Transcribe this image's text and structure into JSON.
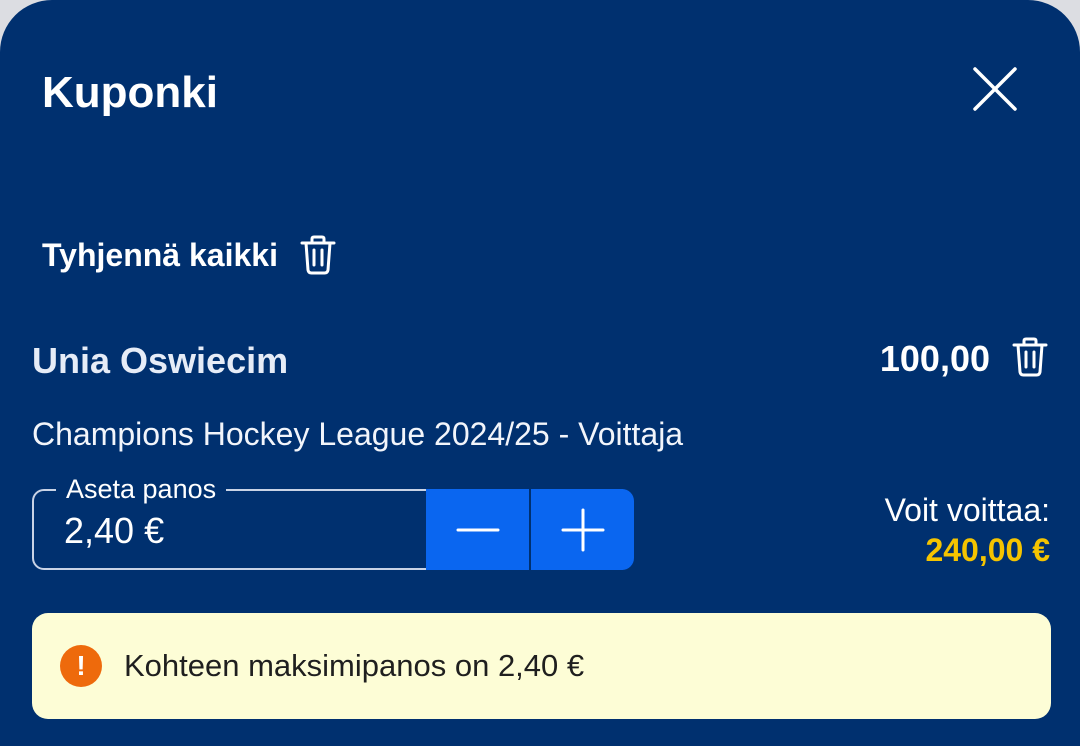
{
  "header": {
    "title": "Kuponki",
    "close_icon": "close-icon"
  },
  "actions": {
    "clear_all_label": "Tyhjennä kaikki",
    "clear_all_icon": "trash-icon"
  },
  "selection": {
    "name": "Unia Oswiecim",
    "odds": "100,00",
    "remove_icon": "trash-icon",
    "market": "Champions Hockey League 2024/25 - Voittaja"
  },
  "stake": {
    "label": "Aseta panos",
    "value": "2,40 €",
    "decrement_icon": "minus-icon",
    "increment_icon": "plus-icon"
  },
  "winnings": {
    "label": "Voit voittaa:",
    "amount": "240,00 €"
  },
  "warning": {
    "icon_glyph": "!",
    "text": "Kohteen maksimipanos on 2,40 €"
  },
  "colors": {
    "background": "#00306f",
    "accent_button": "#0a66f0",
    "win_amount": "#f5c400",
    "warning_bg": "#fdfdd6",
    "warning_icon": "#ee6a0c"
  }
}
